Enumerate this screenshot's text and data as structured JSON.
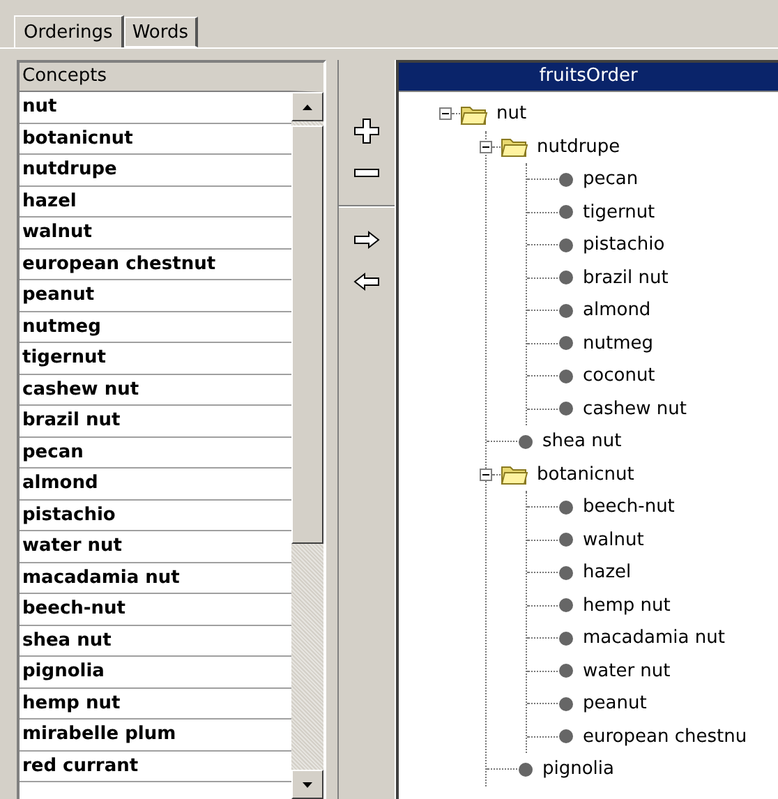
{
  "tabs": [
    {
      "label": "Orderings",
      "selected": true
    },
    {
      "label": "Words",
      "selected": false
    }
  ],
  "concepts": {
    "header": "Concepts",
    "items": [
      "nut",
      "botanicnut",
      "nutdrupe",
      "hazel",
      "walnut",
      "european chestnut",
      "peanut",
      "nutmeg",
      "tigernut",
      "cashew nut",
      "brazil nut",
      "pecan",
      "almond",
      "pistachio",
      "water nut",
      "macadamia nut",
      "beech-nut",
      "shea nut",
      "pignolia",
      "hemp nut",
      "mirabelle plum",
      "red currant"
    ]
  },
  "tools": [
    {
      "kind": "add"
    },
    {
      "kind": "remove"
    },
    {
      "kind": "right"
    },
    {
      "kind": "left"
    }
  ],
  "order": {
    "title": "fruitsOrder",
    "tree": [
      {
        "label": "nut",
        "kind": "folder",
        "expanded": true,
        "children": [
          {
            "label": "nutdrupe",
            "kind": "folder",
            "expanded": true,
            "children": [
              {
                "label": "pecan",
                "kind": "leaf"
              },
              {
                "label": "tigernut",
                "kind": "leaf"
              },
              {
                "label": "pistachio",
                "kind": "leaf"
              },
              {
                "label": "brazil nut",
                "kind": "leaf"
              },
              {
                "label": "almond",
                "kind": "leaf"
              },
              {
                "label": "nutmeg",
                "kind": "leaf"
              },
              {
                "label": "coconut",
                "kind": "leaf"
              },
              {
                "label": "cashew nut",
                "kind": "leaf"
              }
            ]
          },
          {
            "label": "shea nut",
            "kind": "leaf"
          },
          {
            "label": "botanicnut",
            "kind": "folder",
            "expanded": true,
            "children": [
              {
                "label": "beech-nut",
                "kind": "leaf"
              },
              {
                "label": "walnut",
                "kind": "leaf"
              },
              {
                "label": "hazel",
                "kind": "leaf"
              },
              {
                "label": "hemp nut",
                "kind": "leaf"
              },
              {
                "label": "macadamia nut",
                "kind": "leaf"
              },
              {
                "label": "water nut",
                "kind": "leaf"
              },
              {
                "label": "peanut",
                "kind": "leaf"
              },
              {
                "label": "european chestnu",
                "kind": "leaf"
              }
            ]
          },
          {
            "label": "pignolia",
            "kind": "leaf"
          }
        ]
      }
    ]
  }
}
